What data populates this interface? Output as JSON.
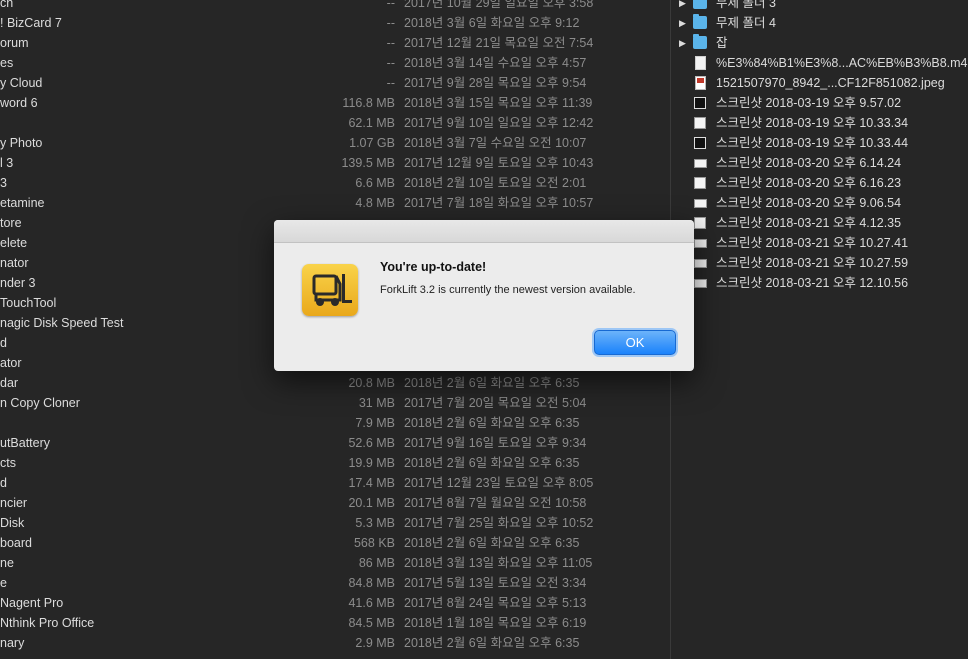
{
  "left_rows": [
    {
      "name": "ch",
      "size": "--",
      "date": "2017년 10월 29일 일요일 오후 3:58"
    },
    {
      "name": "! BizCard 7",
      "size": "--",
      "date": "2018년 3월 6일 화요일 오후 9:12"
    },
    {
      "name": "orum",
      "size": "--",
      "date": "2017년 12월 21일 목요일 오전 7:54"
    },
    {
      "name": "es",
      "size": "--",
      "date": "2018년 3월 14일 수요일 오후 4:57"
    },
    {
      "name": "y Cloud",
      "size": "--",
      "date": "2017년 9월 28일 목요일 오후 9:54"
    },
    {
      "name": "word 6",
      "size": "116.8 MB",
      "date": "2018년 3월 15일 목요일 오후 11:39"
    },
    {
      "name": "",
      "size": "62.1 MB",
      "date": "2017년 9월 10일 일요일 오후 12:42"
    },
    {
      "name": "y Photo",
      "size": "1.07 GB",
      "date": "2018년 3월 7일 수요일 오전 10:07"
    },
    {
      "name": "l 3",
      "size": "139.5 MB",
      "date": "2017년 12월 9일 토요일 오후 10:43"
    },
    {
      "name": " 3",
      "size": "6.6 MB",
      "date": "2018년 2월 10일 토요일 오전 2:01"
    },
    {
      "name": "etamine",
      "size": "4.8 MB",
      "date": "2017년 7월 18일 화요일 오후 10:57"
    },
    {
      "name": "tore",
      "size": "",
      "date": ""
    },
    {
      "name": "elete",
      "size": "",
      "date": ""
    },
    {
      "name": "nator",
      "size": "",
      "date": ""
    },
    {
      "name": "nder 3",
      "size": "",
      "date": ""
    },
    {
      "name": "TouchTool",
      "size": "",
      "date": ""
    },
    {
      "name": "nagic Disk Speed Test",
      "size": "",
      "date": ""
    },
    {
      "name": "d",
      "size": "",
      "date": ""
    },
    {
      "name": "ator",
      "size": "",
      "date": ""
    },
    {
      "name": "dar",
      "size": "20.8 MB",
      "date": "2018년 2월 6일 화요일 오후 6:35"
    },
    {
      "name": "n Copy Cloner",
      "size": "31 MB",
      "date": "2017년 7월 20일 목요일 오전 5:04"
    },
    {
      "name": "",
      "size": "7.9 MB",
      "date": "2018년 2월 6일 화요일 오후 6:35"
    },
    {
      "name": "utBattery",
      "size": "52.6 MB",
      "date": "2017년 9월 16일 토요일 오후 9:34"
    },
    {
      "name": "cts",
      "size": "19.9 MB",
      "date": "2018년 2월 6일 화요일 오후 6:35"
    },
    {
      "name": "d",
      "size": "17.4 MB",
      "date": "2017년 12월 23일 토요일 오후 8:05"
    },
    {
      "name": "ncier",
      "size": "20.1 MB",
      "date": "2017년 8월 7일 월요일 오전 10:58"
    },
    {
      "name": "Disk",
      "size": "5.3 MB",
      "date": "2017년 7월 25일 화요일 오후 10:52"
    },
    {
      "name": "board",
      "size": "568 KB",
      "date": "2018년 2월 6일 화요일 오후 6:35"
    },
    {
      "name": "ne",
      "size": "86 MB",
      "date": "2018년 3월 13일 화요일 오후 11:05"
    },
    {
      "name": "e",
      "size": "84.8 MB",
      "date": "2017년 5월 13일 토요일 오전 3:34"
    },
    {
      "name": "Nagent Pro",
      "size": "41.6 MB",
      "date": "2017년 8월 24일 목요일 오후 5:13"
    },
    {
      "name": "Nthink Pro Office",
      "size": "84.5 MB",
      "date": "2018년 1월 18일 목요일 오후 6:19"
    },
    {
      "name": "nary",
      "size": "2.9 MB",
      "date": "2018년 2월 6일 화요일 오후 6:35"
    }
  ],
  "right_rows": [
    {
      "icon": "folder-icon",
      "expandable": true,
      "name": "무제 폴더 3"
    },
    {
      "icon": "folder-icon",
      "expandable": true,
      "name": "무제 폴더 4"
    },
    {
      "icon": "folder-icon",
      "expandable": true,
      "name": "잡"
    },
    {
      "icon": "audio-file-icon",
      "expandable": false,
      "name": "%E3%84%B1%E3%8...AC%EB%B3%B8.m4a"
    },
    {
      "icon": "jpeg-file-icon",
      "expandable": false,
      "name": "1521507970_8942_...CF12F851082.jpeg"
    },
    {
      "icon": "screenshot-icon",
      "expandable": false,
      "name": "스크린샷 2018-03-19 오후 9.57.02"
    },
    {
      "icon": "screenshot-icon",
      "expandable": false,
      "name": "스크린샷 2018-03-19 오후 10.33.34"
    },
    {
      "icon": "screenshot-icon",
      "expandable": false,
      "name": "스크린샷 2018-03-19 오후 10.33.44"
    },
    {
      "icon": "screenshot-icon",
      "expandable": false,
      "name": "스크린샷 2018-03-20 오후 6.14.24"
    },
    {
      "icon": "screenshot-icon",
      "expandable": false,
      "name": "스크린샷 2018-03-20 오후 6.16.23"
    },
    {
      "icon": "screenshot-icon",
      "expandable": false,
      "name": "스크린샷 2018-03-20 오후 9.06.54"
    },
    {
      "icon": "screenshot-icon",
      "expandable": false,
      "name": "스크린샷 2018-03-21 오후 4.12.35"
    },
    {
      "icon": "screenshot-icon",
      "expandable": false,
      "name": "스크린샷 2018-03-21 오후 10.27.41"
    },
    {
      "icon": "screenshot-icon",
      "expandable": false,
      "name": "스크린샷 2018-03-21 오후 10.27.59"
    },
    {
      "icon": "screenshot-icon",
      "expandable": false,
      "name": "스크린샷 2018-03-21 오후 12.10.56"
    }
  ],
  "dialog": {
    "title": "You're up-to-date!",
    "message": "ForkLift 3.2 is currently the newest version available.",
    "ok_label": "OK",
    "app_icon": "forklift-app-icon"
  }
}
